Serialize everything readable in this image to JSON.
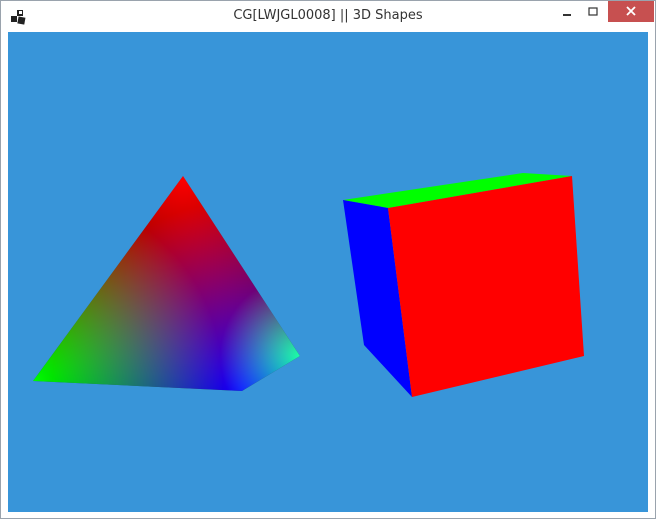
{
  "window": {
    "title": "CG[LWJGL0008] || 3D Shapes",
    "app_icon": "lwjgl-logo-icon",
    "controls": {
      "minimize": "minimize-icon",
      "maximize": "maximize-icon",
      "close": "close-icon"
    }
  },
  "scene": {
    "background_color": "#3895d9",
    "pyramid": {
      "vertex_colors": [
        "#ff0000",
        "#00ff00",
        "#0000ff",
        "#00ff00"
      ]
    },
    "cube": {
      "face_colors": {
        "front": "#ff0000",
        "left": "#0000ff",
        "top": "#00ff00"
      }
    }
  }
}
